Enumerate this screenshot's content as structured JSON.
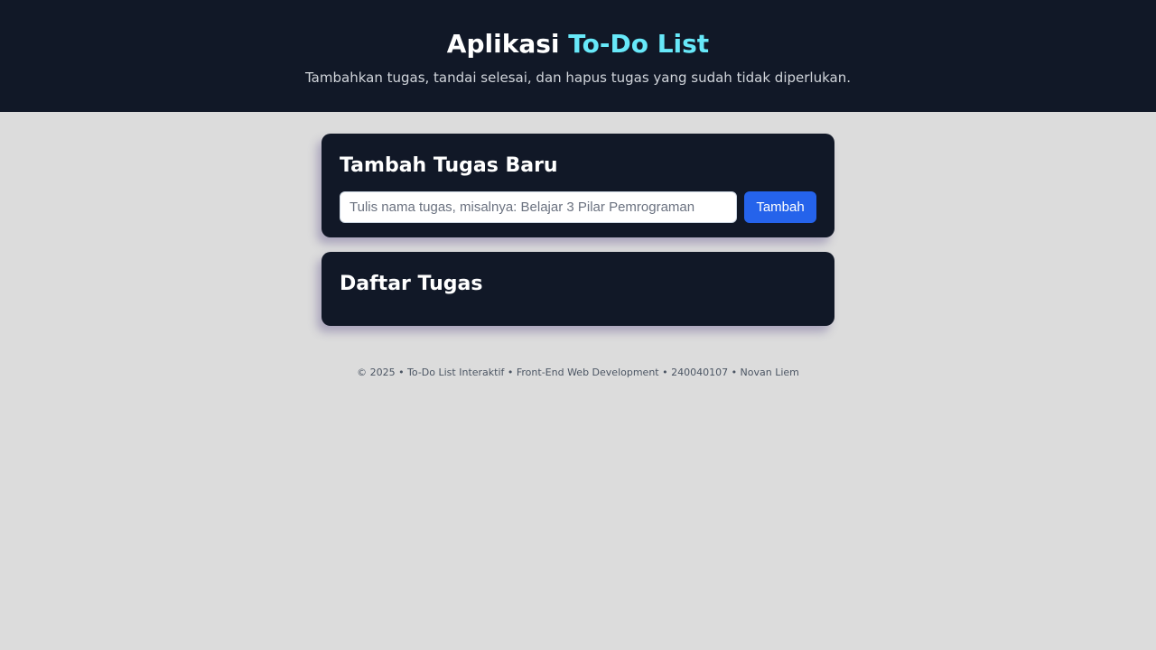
{
  "header": {
    "title_prefix": "Aplikasi",
    "title_accent": "To-Do List",
    "subtitle": "Tambahkan tugas, tandai selesai, dan hapus tugas yang sudah tidak diperlukan."
  },
  "add_card": {
    "heading": "Tambah Tugas Baru",
    "input_value": "",
    "input_placeholder": "Tulis nama tugas, misalnya: Belajar 3 Pilar Pemrograman",
    "button_label": "Tambah"
  },
  "list_card": {
    "heading": "Daftar Tugas",
    "tasks": []
  },
  "footer": {
    "text": "© 2025 • To-Do List Interaktif • Front-End Web Development • 240040107 • Novan Liem"
  },
  "colors": {
    "header_bg": "#111827",
    "card_bg": "#111827",
    "page_bg": "#dcdcdc",
    "accent": "#67e8f9",
    "button_bg": "#2563eb"
  }
}
